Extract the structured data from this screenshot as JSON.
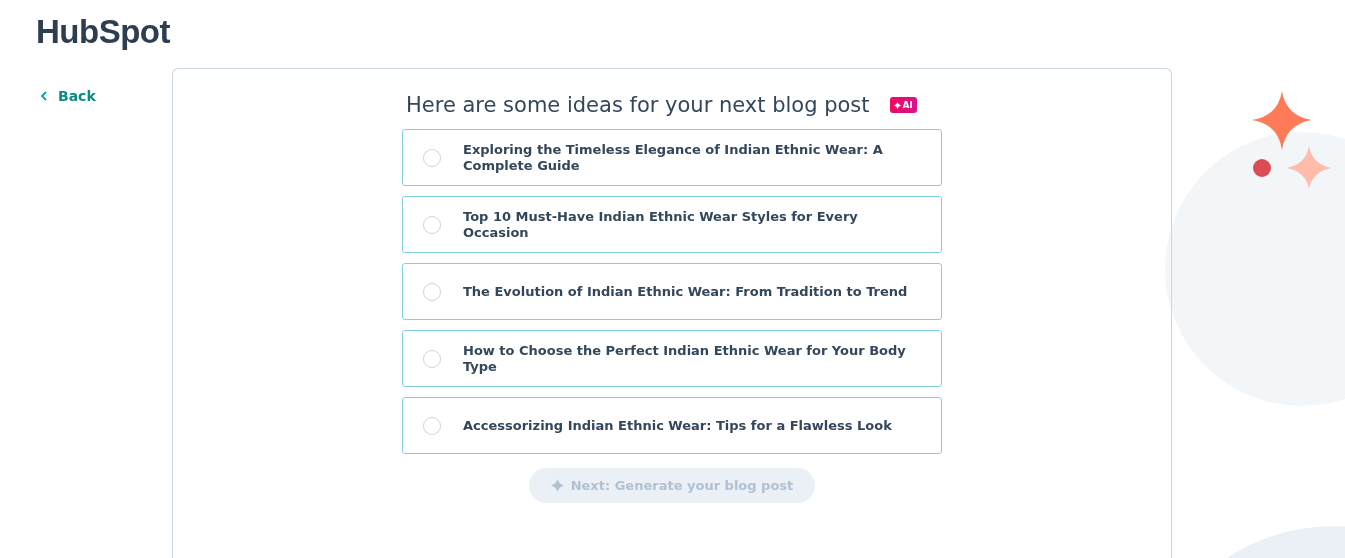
{
  "logo": "HubSpot",
  "back": {
    "label": "Back"
  },
  "heading": "Here are some ideas for your next blog post",
  "badge": "AI",
  "ideas": [
    {
      "title": "Exploring the Timeless Elegance of Indian Ethnic Wear: A Complete Guide",
      "selected": false
    },
    {
      "title": "Top 10 Must-Have Indian Ethnic Wear Styles for Every Occasion",
      "selected": false
    },
    {
      "title": "The Evolution of Indian Ethnic Wear: From Tradition to Trend",
      "selected": false
    },
    {
      "title": "How to Choose the Perfect Indian Ethnic Wear for Your Body Type",
      "selected": false
    },
    {
      "title": "Accessorizing Indian Ethnic Wear: Tips for a Flawless Look",
      "selected": false
    }
  ],
  "next_button": {
    "label": "Next: Generate your blog post",
    "disabled": true
  }
}
